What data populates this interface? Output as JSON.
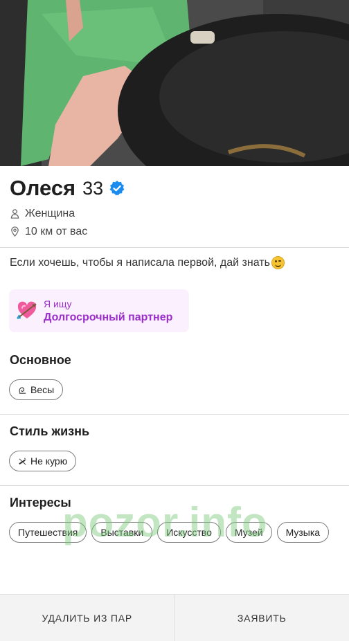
{
  "profile": {
    "name": "Олеся",
    "age": "33",
    "gender": "Женщина",
    "distance": "10 км от вас",
    "bio": "Если хочешь, чтобы я написала первой, дай знать"
  },
  "looking_for": {
    "label": "Я ищу",
    "value": "Долгосрочный партнер"
  },
  "sections": {
    "basic": {
      "title": "Основное",
      "chips": [
        "Весы"
      ]
    },
    "lifestyle": {
      "title": "Стиль жизнь",
      "chips": [
        "Не курю"
      ]
    },
    "interests": {
      "title": "Интересы",
      "chips": [
        "Путешествия",
        "Выставки",
        "Искусство",
        "Музей",
        "Музыка"
      ]
    }
  },
  "watermark": "pozor.info",
  "actions": {
    "remove": "УДАЛИТЬ ИЗ ПАР",
    "report": "ЗАЯВИТЬ"
  },
  "colors": {
    "accent_purple": "#9b2fc9",
    "verified_blue": "#1a8cf0",
    "seek_card_bg": "#fbf0fd"
  }
}
